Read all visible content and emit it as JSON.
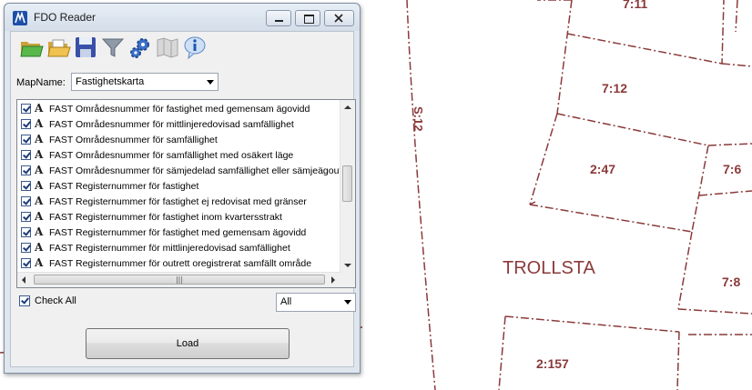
{
  "window": {
    "title": "FDO Reader",
    "buttons": [
      "minimize",
      "maximize",
      "close"
    ]
  },
  "toolbar": {
    "icons": [
      "open-folder-green-icon",
      "open-folder-icon",
      "save-disk-icon",
      "filter-funnel-icon",
      "settings-gears-icon",
      "map-icon",
      "info-icon"
    ]
  },
  "mapname": {
    "label": "MapName:",
    "value": "Fastighetskarta"
  },
  "layers": [
    {
      "label": "FAST Områdesnummer för fastighet med gemensam ägovidd",
      "checked": true
    },
    {
      "label": "FAST Områdesnummer för mittlinjeredovisad samfällighet",
      "checked": true
    },
    {
      "label": "FAST Områdesnummer för samfällighet",
      "checked": true
    },
    {
      "label": "FAST Områdesnummer för samfällighet med osäkert läge",
      "checked": true
    },
    {
      "label": "FAST Områdesnummer för sämjedelad samfällighet eller sämjeägout",
      "checked": true
    },
    {
      "label": "FAST Registernummer för fastighet",
      "checked": true
    },
    {
      "label": "FAST Registernummer för fastighet ej redovisat med gränser",
      "checked": true
    },
    {
      "label": "FAST Registernummer för fastighet inom kvartersstrakt",
      "checked": true
    },
    {
      "label": "FAST Registernummer för fastighet med gemensam ägovidd",
      "checked": true
    },
    {
      "label": "FAST Registernummer för mittlinjeredovisad samfällighet",
      "checked": true
    },
    {
      "label": "FAST Registernummer för outrett oregistrerat samfällt område",
      "checked": true
    }
  ],
  "checkall": {
    "label": "Check All",
    "checked": true
  },
  "filter": {
    "value": "All"
  },
  "load_button": {
    "label": "Load"
  },
  "map": {
    "labels": [
      "7:11",
      "7:12",
      "2:47",
      "7:6",
      "S:12",
      "TROLLSTA",
      "7:8",
      "2:157"
    ],
    "color": "#8b3a3a"
  }
}
